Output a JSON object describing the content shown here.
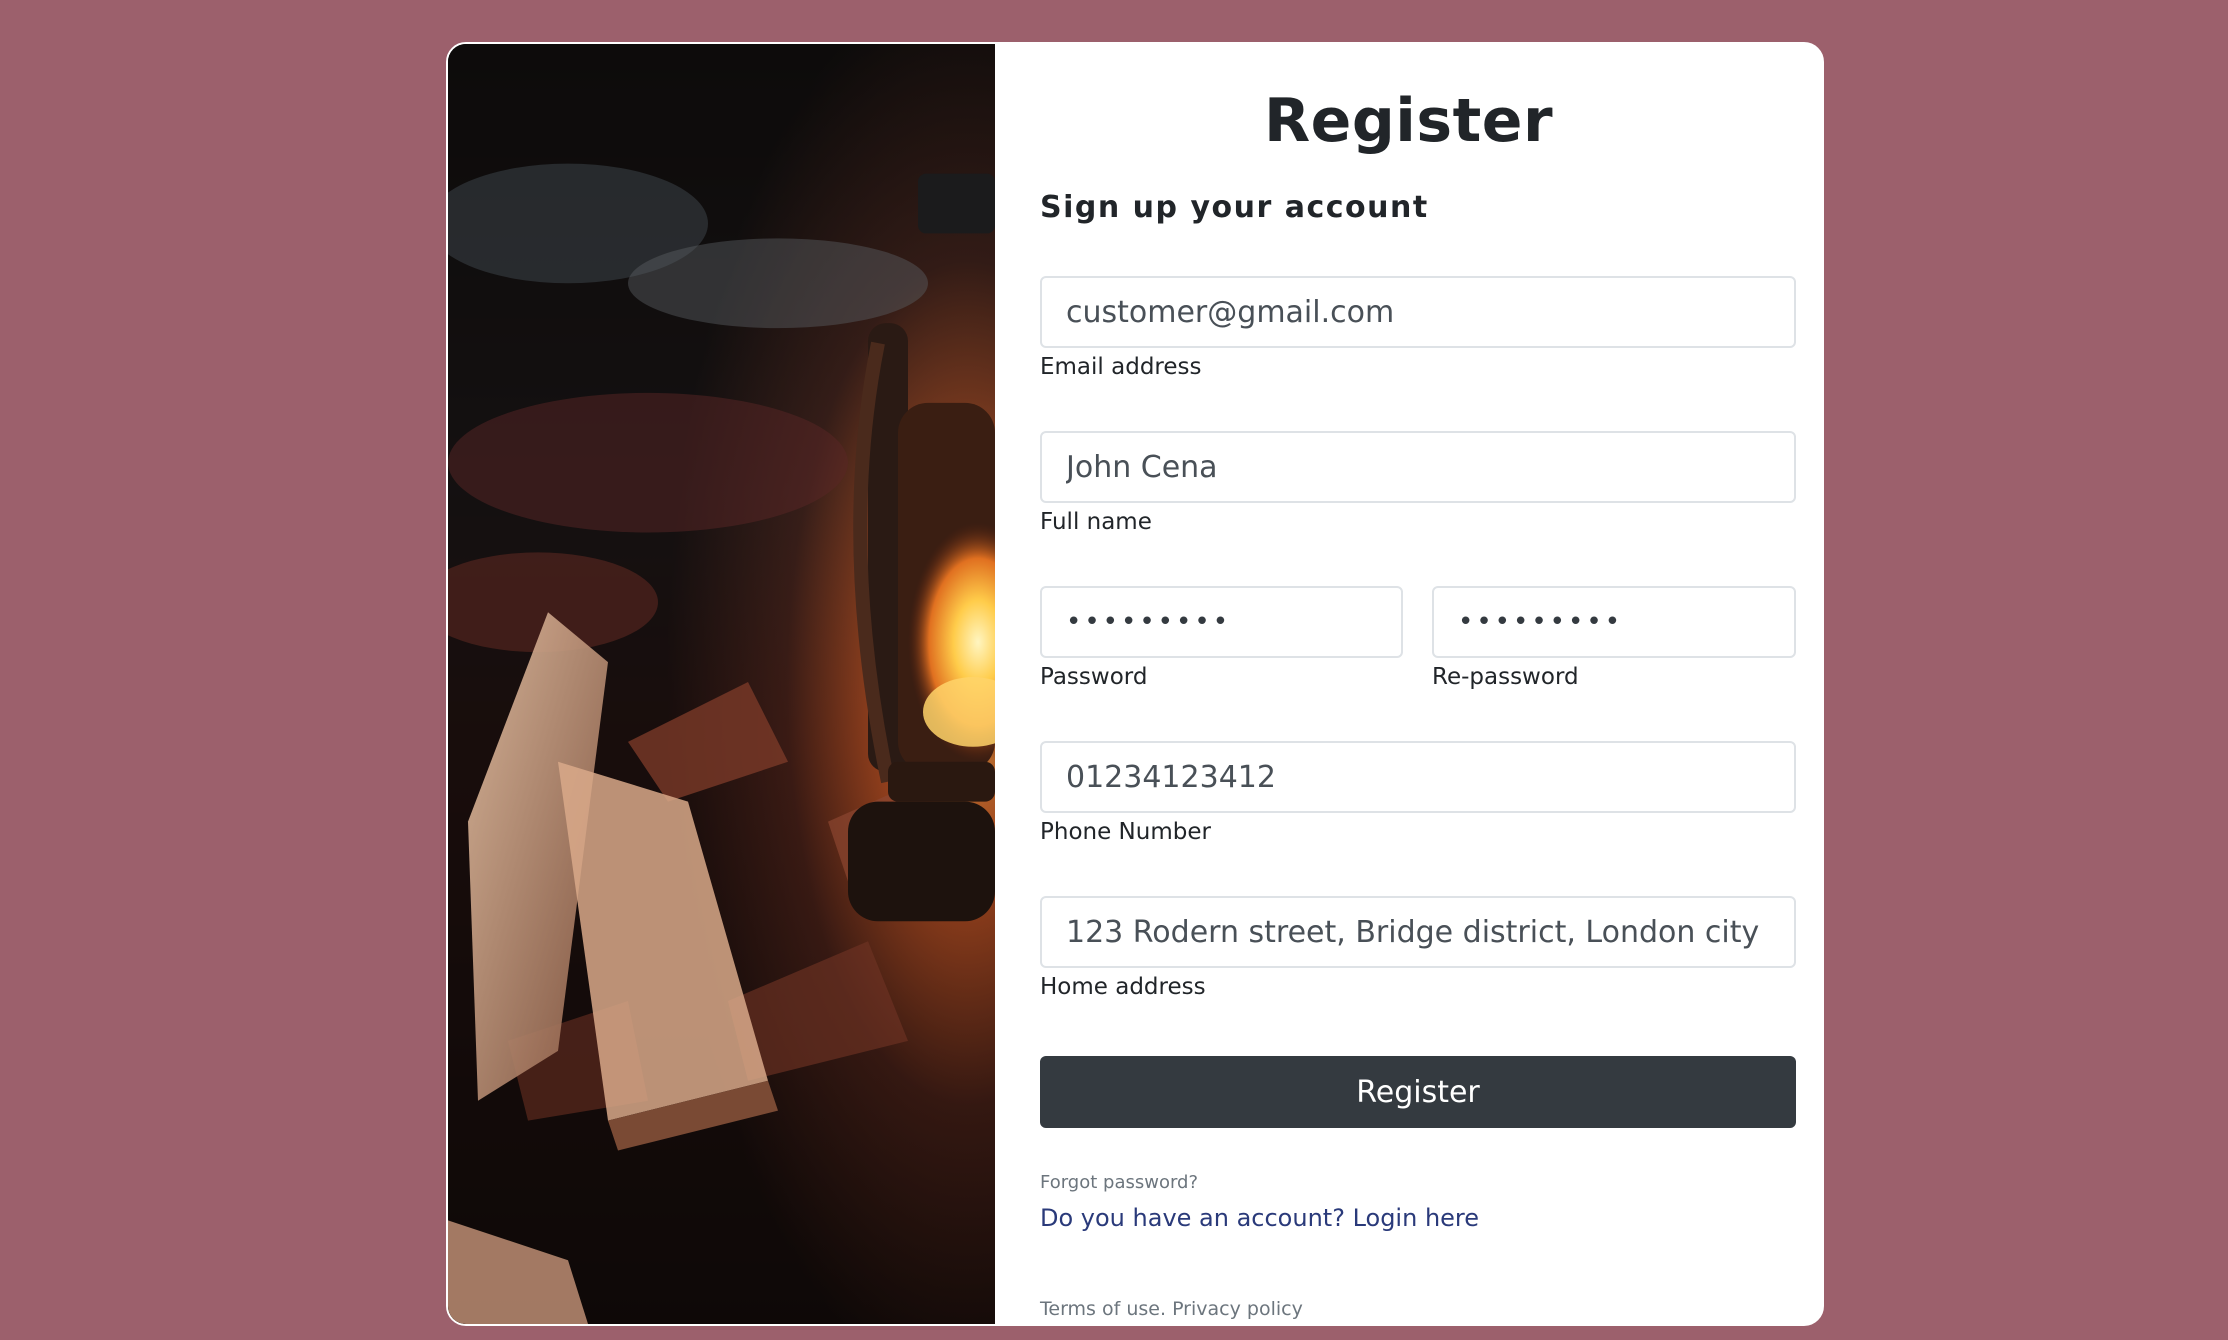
{
  "page": {
    "title": "Register",
    "subtitle": "Sign up your account"
  },
  "form": {
    "email": {
      "value": "customer@gmail.com",
      "label": "Email address"
    },
    "full_name": {
      "value": "John Cena",
      "label": "Full name"
    },
    "password": {
      "value": "•••••••••",
      "label": "Password"
    },
    "re_password": {
      "value": "•••••••••",
      "label": "Re-password"
    },
    "phone": {
      "value": "01234123412",
      "label": "Phone Number"
    },
    "address": {
      "value": "123 Rodern street, Bridge district, London city",
      "label": "Home address"
    },
    "submit_label": "Register"
  },
  "links": {
    "forgot_password": "Forgot password?",
    "login": "Do you have an account? Login here",
    "terms": "Terms of use.",
    "privacy": "Privacy policy"
  },
  "colors": {
    "background": "#9c606c",
    "button": "#343a40",
    "link": "#2a3a7a"
  },
  "image": {
    "subject": "lantern-and-book-photo"
  }
}
